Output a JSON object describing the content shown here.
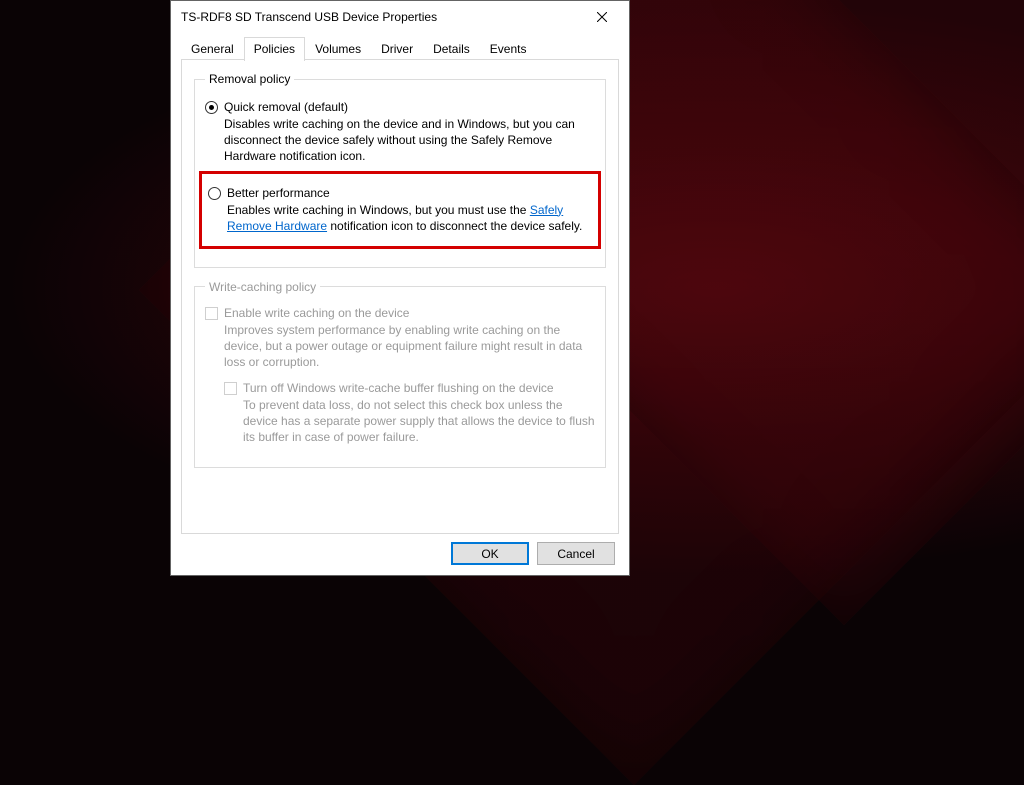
{
  "window": {
    "title": "TS-RDF8 SD  Transcend USB Device Properties"
  },
  "tabs": [
    "General",
    "Policies",
    "Volumes",
    "Driver",
    "Details",
    "Events"
  ],
  "activeTab": "Policies",
  "removalPolicy": {
    "legend": "Removal policy",
    "quick": {
      "label": "Quick removal (default)",
      "desc": "Disables write caching on the device and in Windows, but you can disconnect the device safely without using the Safely Remove Hardware notification icon.",
      "selected": true
    },
    "better": {
      "label": "Better performance",
      "desc_before": "Enables write caching in Windows, but you must use the ",
      "link": "Safely Remove Hardware",
      "desc_after": " notification icon to disconnect the device safely.",
      "selected": false
    }
  },
  "writeCaching": {
    "legend": "Write-caching policy",
    "enable": {
      "label": "Enable write caching on the device",
      "desc": "Improves system performance by enabling write caching on the device, but a power outage or equipment failure might result in data loss or corruption.",
      "checked": false,
      "enabled": false
    },
    "turnoff": {
      "label": "Turn off Windows write-cache buffer flushing on the device",
      "desc": "To prevent data loss, do not select this check box unless the device has a separate power supply that allows the device to flush its buffer in case of power failure.",
      "checked": false,
      "enabled": false
    }
  },
  "buttons": {
    "ok": "OK",
    "cancel": "Cancel"
  }
}
